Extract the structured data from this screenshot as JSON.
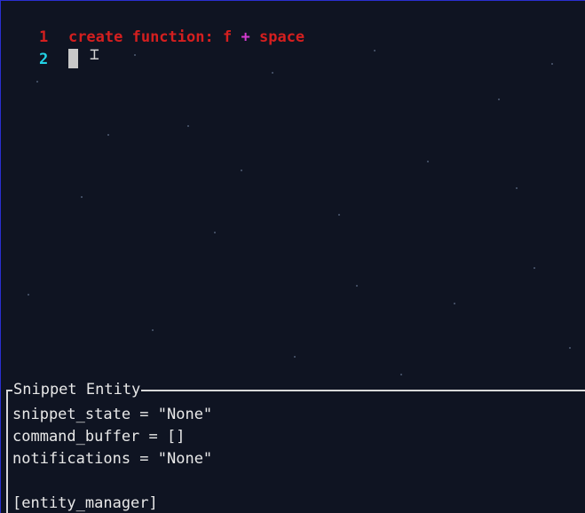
{
  "editor": {
    "lines": [
      {
        "number": "1",
        "keyword": "create function",
        "colon": ":",
        "f": "f",
        "plus": "+",
        "space": "space"
      },
      {
        "number": "2"
      }
    ]
  },
  "panel": {
    "title": "Snippet Entity",
    "lines": [
      "snippet_state = \"None\"",
      "command_buffer = []",
      "notifications = \"None\"",
      "",
      "[entity_manager]"
    ]
  },
  "colors": {
    "background": "#0f1422",
    "line1": "#d41f1f",
    "line2": "#22d3e6",
    "plus": "#d63bd1",
    "text": "#e8e8e8"
  }
}
